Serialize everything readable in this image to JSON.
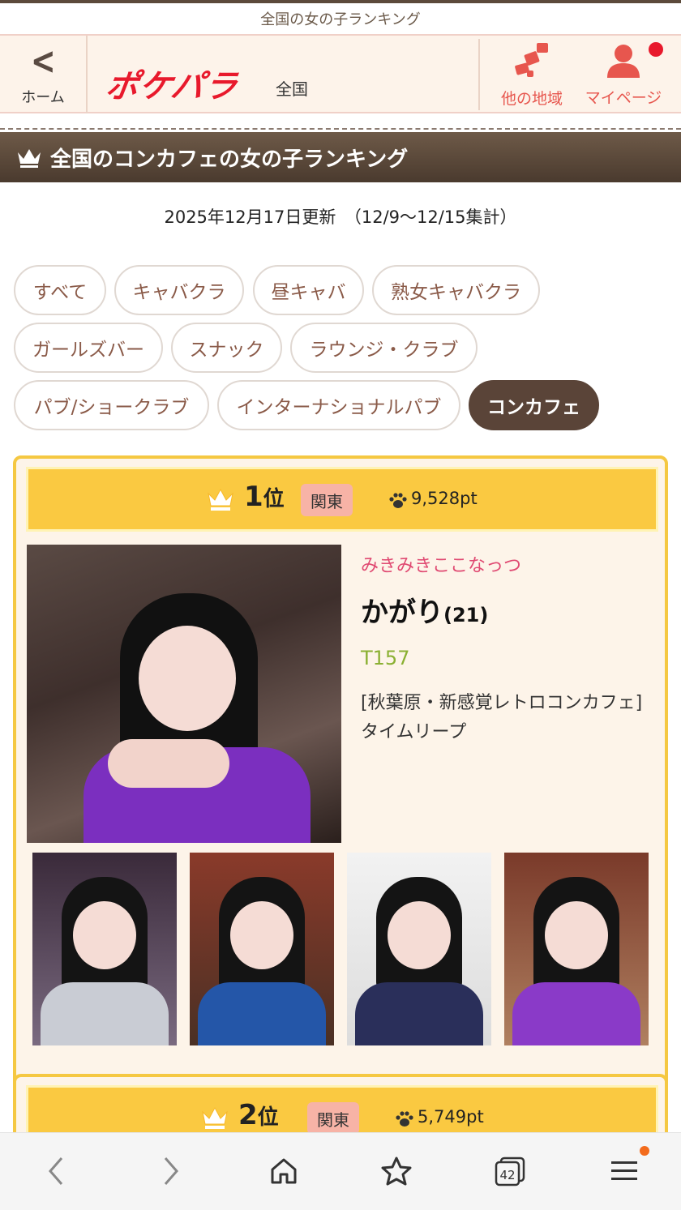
{
  "topbar": {
    "title": "全国の女の子ランキング"
  },
  "header": {
    "home_label": "ホーム",
    "logo_text": "ポケパラ",
    "region": "全国",
    "area_label": "他の地域",
    "mypage_label": "マイページ"
  },
  "page": {
    "title": "全国のコンカフェの女の子ランキング",
    "updated": "2025年12月17日更新　（12/9〜12/15集計）"
  },
  "categories": [
    "すべて",
    "キャバクラ",
    "昼キャバ",
    "熟女キャバクラ",
    "ガールズバー",
    "スナック",
    "ラウンジ・クラブ",
    "パブ/ショークラブ",
    "インターナショナルパブ",
    "コンカフェ"
  ],
  "active_category": "コンカフェ",
  "ranking": [
    {
      "rank": "1",
      "rank_suffix": "位",
      "region": "関東",
      "points": "9,528pt",
      "shop": "みきみきここなっつ",
      "name": "かがり",
      "age": "(21)",
      "height": "T157",
      "shop_info": "[秋葉原・新感覚レトロコンカフェ] タイムリープ"
    },
    {
      "rank": "2",
      "rank_suffix": "位",
      "region": "関東",
      "points": "5,749pt"
    }
  ],
  "bottom_nav": {
    "tabs_count": "42"
  },
  "colors": {
    "brand_red": "#e8192c",
    "header_brown": "#5a4438",
    "rank_gold": "#fac941",
    "shop_pink": "#e04a72",
    "height_green": "#8ab032"
  }
}
